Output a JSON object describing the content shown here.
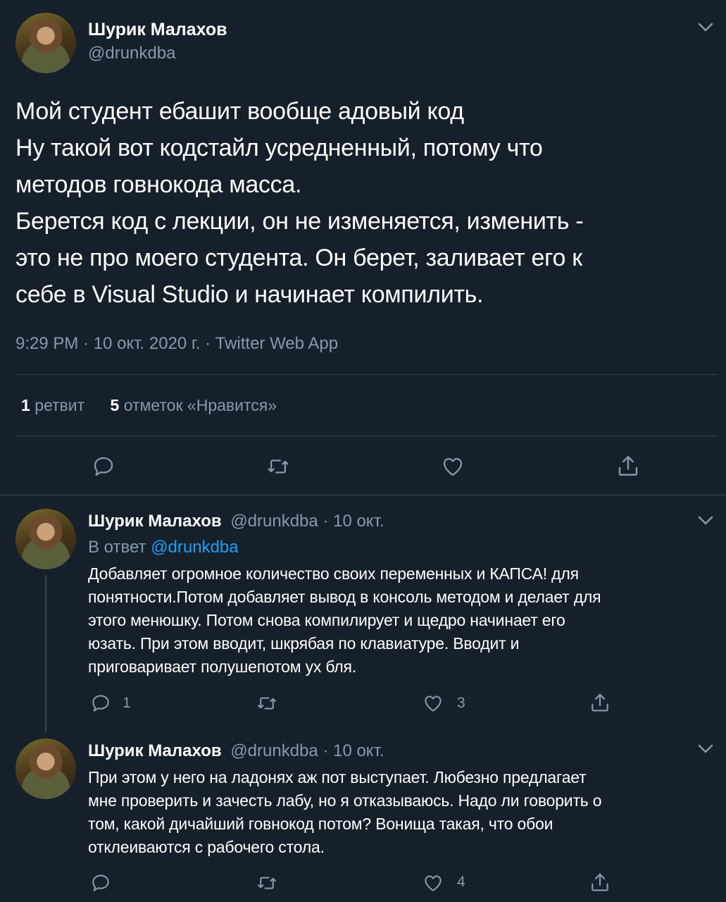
{
  "main_tweet": {
    "author_name": "Шурик Малахов",
    "author_handle": "@drunkdba",
    "text_lines": [
      "Мой студент ебашит вообще адовый код",
      "Ну такой вот кодстайл усредненный, потому что",
      "методов говнокода масса.",
      "Берется код с лекции, он не изменяется, изменить -",
      "это не про моего студента. Он берет, заливает его к",
      "себе в Visual Studio и начинает компилить."
    ],
    "meta": "9:29 PM · 10 окт. 2020 г. · Twitter Web App",
    "retweet_count": "1",
    "retweet_label": "ретвит",
    "like_count": "5",
    "like_label": "отметок «Нравится»"
  },
  "replies": [
    {
      "author_name": "Шурик Малахов",
      "author_handle": "@drunkdba",
      "date": "· 10 окт.",
      "reply_to_prefix": "В ответ",
      "reply_to_handle": "@drunkdba",
      "text_lines": [
        "Добавляет огромное количество своих переменных и КАПСА! для",
        "понятности.Потом добавляет вывод в консоль методом и делает для",
        "этого менюшку. Потом снова компилирует и щедро начинает его",
        "юзать. При этом вводит, шкрябая по клавиатуре. Вводит и",
        "приговаривает полушепотом ух бля."
      ],
      "reply_count": "1",
      "like_count": "3"
    },
    {
      "author_name": "Шурик Малахов",
      "author_handle": "@drunkdba",
      "date": "· 10 окт.",
      "text_lines": [
        "При этом у него на ладонях аж пот выступает. Любезно предлагает",
        "мне проверить и зачесть лабу, но я отказываюсь. Надо ли говорить о",
        "том, какой дичайший говнокод потом? Вонища такая, что обои",
        "отклеиваются с рабочего стола."
      ],
      "like_count": "4"
    }
  ],
  "colors": {
    "background": "#15202b",
    "muted": "#8899a6",
    "link": "#1da1f2",
    "divider": "#38444d"
  },
  "icons": [
    "chevron-down-icon",
    "reply-icon",
    "retweet-icon",
    "like-icon",
    "share-icon"
  ]
}
